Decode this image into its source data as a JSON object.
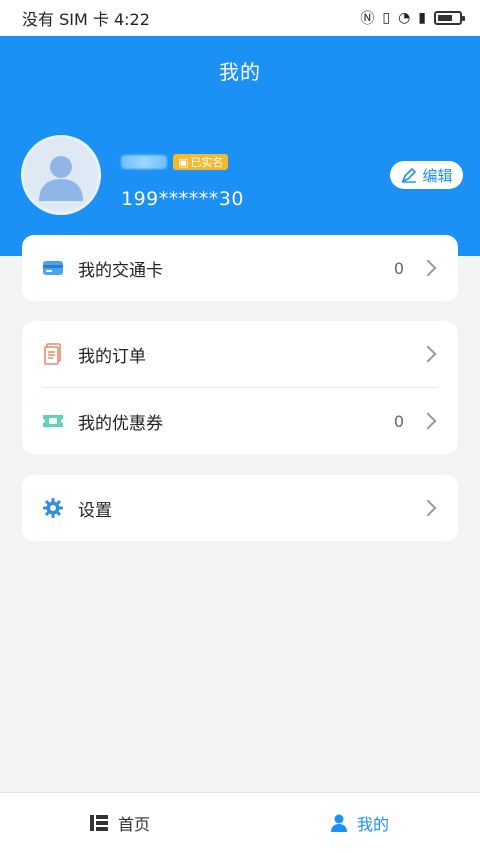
{
  "status_bar": {
    "carrier_time": "没有 SIM 卡 4:22"
  },
  "header": {
    "title": "我的"
  },
  "profile": {
    "verified_badge": "已实名",
    "phone": "199******30",
    "edit_label": "编辑"
  },
  "menu": {
    "transit_card": {
      "label": "我的交通卡",
      "count": "0"
    },
    "orders": {
      "label": "我的订单"
    },
    "coupons": {
      "label": "我的优惠券",
      "count": "0"
    },
    "settings": {
      "label": "设置"
    }
  },
  "tabbar": {
    "home_label": "首页",
    "mine_label": "我的"
  },
  "colors": {
    "accent": "#1b91f5",
    "badge": "#f5b82e",
    "background": "#f2f3f4"
  }
}
